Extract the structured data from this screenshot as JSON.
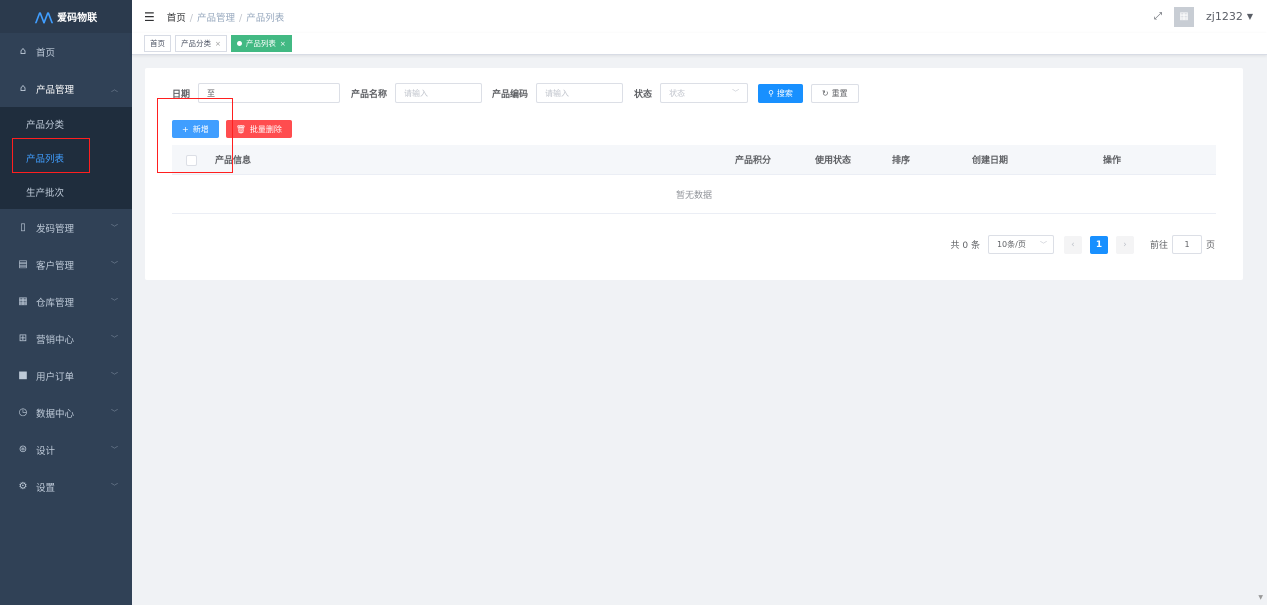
{
  "sidebar": {
    "logo": "爱码物联",
    "items": [
      {
        "label": "首页",
        "icon": "home-icon",
        "glyph": "⌂"
      },
      {
        "label": "产品管理",
        "icon": "shop-icon",
        "glyph": "⌂"
      },
      {
        "label": "发码管理",
        "icon": "phone-icon",
        "glyph": "▯"
      },
      {
        "label": "客户管理",
        "icon": "building-icon",
        "glyph": "▤"
      },
      {
        "label": "仓库管理",
        "icon": "warehouse-icon",
        "glyph": "▦"
      },
      {
        "label": "营销中心",
        "icon": "gift-icon",
        "glyph": "⊞"
      },
      {
        "label": "用户订单",
        "icon": "order-icon",
        "glyph": "■"
      },
      {
        "label": "数据中心",
        "icon": "clock-icon",
        "glyph": "◷"
      },
      {
        "label": "设计",
        "icon": "design-icon",
        "glyph": "⊛"
      },
      {
        "label": "设置",
        "icon": "settings-icon",
        "glyph": "⚙"
      }
    ],
    "sub_items": [
      "产品分类",
      "产品列表",
      "生产批次"
    ]
  },
  "header": {
    "breadcrumbs": [
      "首页",
      "产品管理",
      "产品列表"
    ],
    "username": "zj1232"
  },
  "tags": [
    {
      "label": "首页"
    },
    {
      "label": "产品分类"
    },
    {
      "label": "产品列表"
    }
  ],
  "filters": {
    "date_label": "日期",
    "date_separator": "至",
    "name_label": "产品名称",
    "name_placeholder": "请输入",
    "code_label": "产品编码",
    "code_placeholder": "请输入",
    "status_label": "状态",
    "status_placeholder": "状态",
    "search_btn": "搜索",
    "reset_btn": "重置"
  },
  "actions": {
    "add_btn": "新增",
    "batch_delete_btn": "批量删除"
  },
  "table": {
    "columns": [
      "产品信息",
      "产品积分",
      "使用状态",
      "排序",
      "创建日期",
      "操作"
    ],
    "empty_text": "暂无数据"
  },
  "pagination": {
    "total_text": "共 0 条",
    "page_size": "10条/页",
    "current_page": "1",
    "goto_label": "前往",
    "goto_value": "1",
    "page_suffix": "页"
  },
  "colors": {
    "sidebar_bg": "#304156",
    "primary": "#1890ff",
    "tag_active": "#42b983",
    "danger": "#ff4d4f",
    "highlight": "#ff1f1f"
  }
}
